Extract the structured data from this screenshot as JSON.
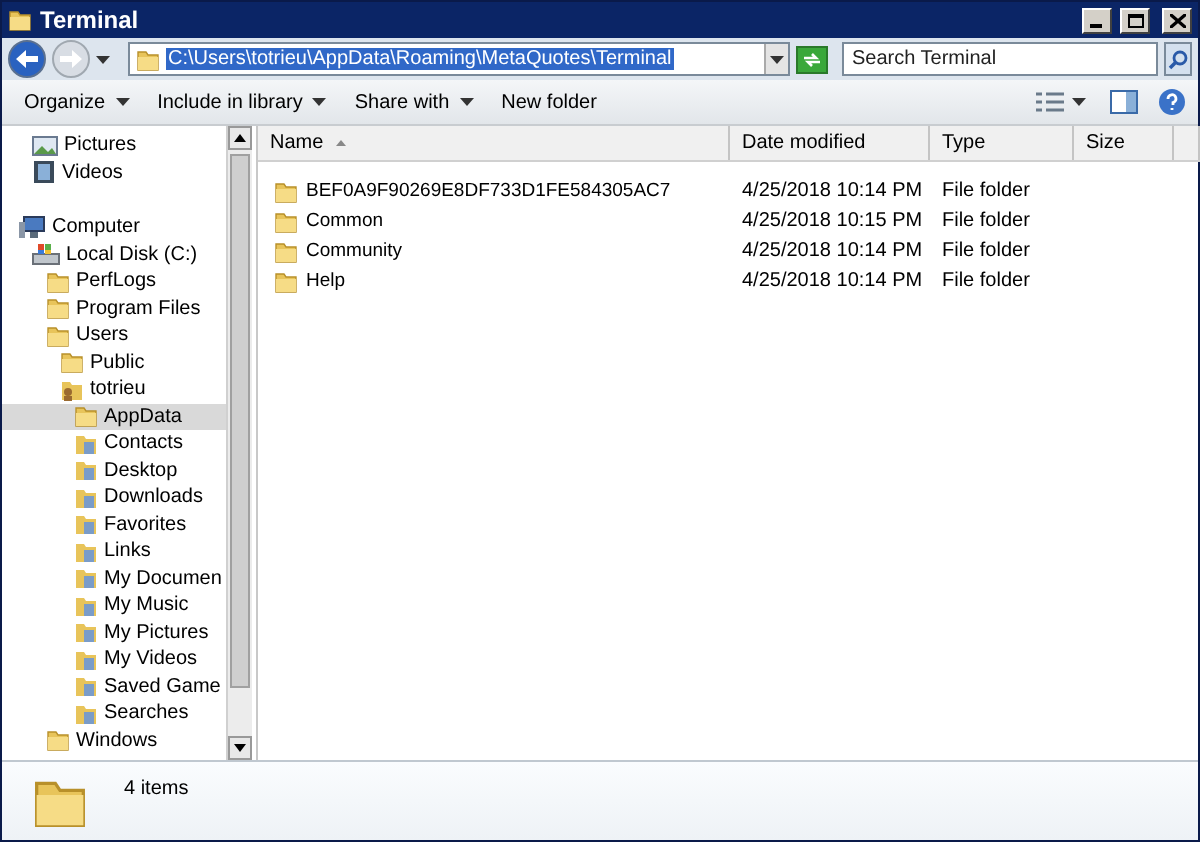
{
  "window": {
    "title": "Terminal"
  },
  "address": {
    "path": "C:\\Users\\totrieu\\AppData\\Roaming\\MetaQuotes\\Terminal"
  },
  "search": {
    "placeholder": "Search Terminal"
  },
  "toolbar": [
    {
      "label": "Organize",
      "menu": true
    },
    {
      "label": "Include in library",
      "menu": true
    },
    {
      "label": "Share with",
      "menu": true
    },
    {
      "label": "New folder",
      "menu": false
    }
  ],
  "nav": {
    "libraries": [
      {
        "label": "Pictures",
        "kind": "pictures",
        "selected": false
      },
      {
        "label": "Videos",
        "kind": "videos",
        "selected": false
      }
    ],
    "tree": [
      {
        "label": "Computer",
        "kind": "computer",
        "selected": false,
        "children": [
          {
            "label": "Local Disk (C:)",
            "kind": "drive",
            "selected": false,
            "children": [
              {
                "label": "PerfLogs",
                "kind": "folder",
                "selected": false
              },
              {
                "label": "Program Files",
                "kind": "folder",
                "selected": false
              },
              {
                "label": "Users",
                "kind": "folder",
                "selected": false,
                "children": [
                  {
                    "label": "Public",
                    "kind": "folder",
                    "selected": false
                  },
                  {
                    "label": "totrieu",
                    "kind": "user",
                    "selected": false,
                    "children": [
                      {
                        "label": "AppData",
                        "kind": "folder",
                        "selected": true
                      },
                      {
                        "label": "Contacts",
                        "kind": "special",
                        "selected": false
                      },
                      {
                        "label": "Desktop",
                        "kind": "special",
                        "selected": false
                      },
                      {
                        "label": "Downloads",
                        "kind": "special",
                        "selected": false
                      },
                      {
                        "label": "Favorites",
                        "kind": "special",
                        "selected": false
                      },
                      {
                        "label": "Links",
                        "kind": "special",
                        "selected": false
                      },
                      {
                        "label": "My Documen",
                        "kind": "special",
                        "selected": false
                      },
                      {
                        "label": "My Music",
                        "kind": "special",
                        "selected": false
                      },
                      {
                        "label": "My Pictures",
                        "kind": "special",
                        "selected": false
                      },
                      {
                        "label": "My Videos",
                        "kind": "special",
                        "selected": false
                      },
                      {
                        "label": "Saved Game",
                        "kind": "special",
                        "selected": false
                      },
                      {
                        "label": "Searches",
                        "kind": "special",
                        "selected": false
                      }
                    ]
                  }
                ]
              },
              {
                "label": "Windows",
                "kind": "folder",
                "selected": false
              }
            ]
          }
        ]
      }
    ]
  },
  "table": {
    "columns": [
      {
        "label": "Name",
        "sorted": true
      },
      {
        "label": "Date modified",
        "sorted": false
      },
      {
        "label": "Type",
        "sorted": false
      },
      {
        "label": "Size",
        "sorted": false
      }
    ],
    "rows": [
      [
        "BEF0A9F90269E8DF733D1FE584305AC7",
        "4/25/2018 10:14 PM",
        "File folder"
      ],
      [
        "Common",
        "4/25/2018 10:15 PM",
        "File folder"
      ],
      [
        "Community",
        "4/25/2018 10:14 PM",
        "File folder"
      ],
      [
        "Help",
        "4/25/2018 10:14 PM",
        "File folder"
      ]
    ]
  },
  "status_bar": {
    "count": "4 items"
  }
}
